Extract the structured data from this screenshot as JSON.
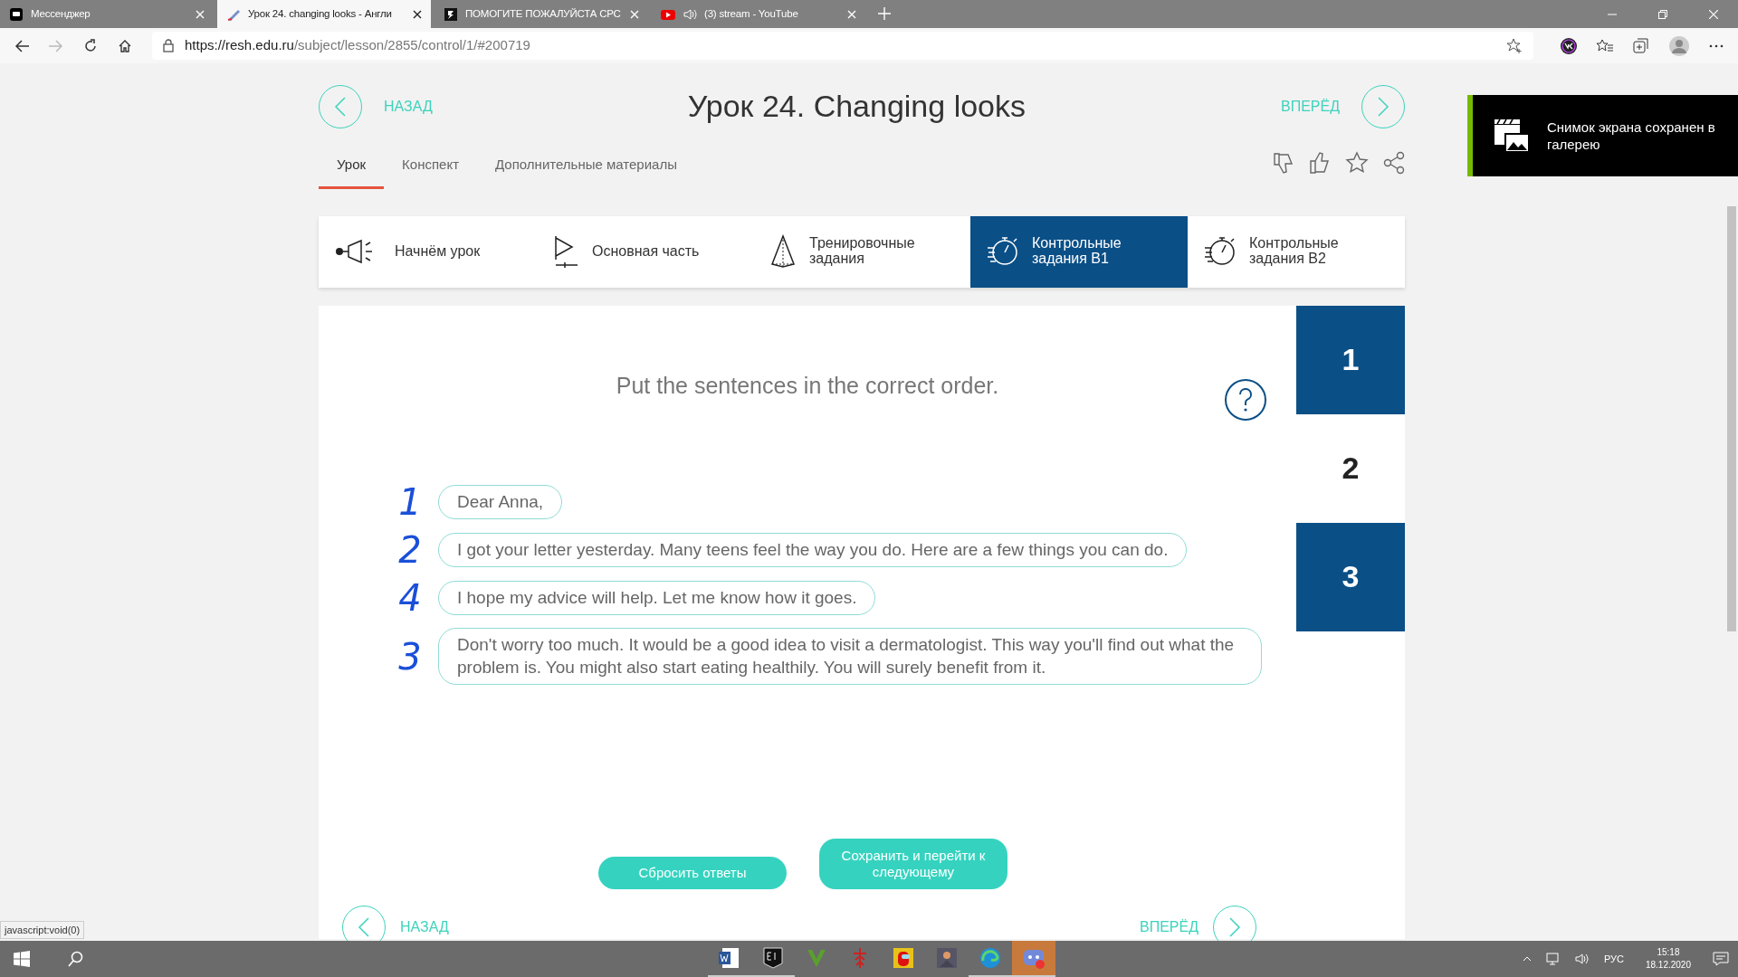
{
  "browser": {
    "tabs": [
      {
        "kind": "messenger",
        "title": "Мессенджер",
        "selected": false,
        "audio": false
      },
      {
        "kind": "lesson",
        "title": "Урок 24. changing looks - Англи",
        "selected": true,
        "audio": false
      },
      {
        "kind": "letter",
        "title": "ПОМОГИТЕ ПОЖАЛУЙСТА СРС",
        "selected": false,
        "audio": false
      },
      {
        "kind": "video",
        "title": "(3) stream - YouTube",
        "selected": false,
        "audio": true
      }
    ],
    "url": {
      "host": "https://resh.edu.ru",
      "path": "/subject/lesson/2855/control/1/#200719"
    },
    "status_text": "javascript:void(0)"
  },
  "page": {
    "prev_label": "НАЗАД",
    "next_label": "ВПЕРЁД",
    "title": "Урок 24. Changing looks",
    "lesson_tabs": [
      {
        "label": "Урок",
        "selected": true
      },
      {
        "label": "Конспект",
        "selected": false
      },
      {
        "label": "Дополнительные материалы",
        "selected": false
      }
    ],
    "sections": [
      {
        "kind": "megaphone",
        "label": "Начнём урок",
        "selected": false
      },
      {
        "kind": "play",
        "label": "Основная часть",
        "selected": false
      },
      {
        "kind": "pyramid",
        "label": "Тренировочные задания",
        "selected": false
      },
      {
        "kind": "timer",
        "label": "Контрольные задания В1",
        "selected": true
      },
      {
        "kind": "timer",
        "label": "Контрольные задания В2",
        "selected": false
      }
    ],
    "task": {
      "instruction": "Put the sentences in the correct order.",
      "numbers": [
        {
          "label": "1",
          "answered": true
        },
        {
          "label": "2",
          "answered": false
        },
        {
          "label": "3",
          "answered": true
        }
      ],
      "sentences": [
        {
          "annotation": "1",
          "text": "Dear Anna,"
        },
        {
          "annotation": "2",
          "text": "I got your letter yesterday. Many teens feel the way you do. Here are a few things you can do."
        },
        {
          "annotation": "4",
          "text": "I hope my advice will help. Let me know how it goes."
        },
        {
          "annotation": "3",
          "text": "Don't worry too much. It would be a good idea to visit a dermatologist. This way you'll find out what the problem is. You might also start eating healthily. You will surely benefit from it."
        }
      ]
    },
    "buttons": [
      "Сбросить ответы",
      "Сохранить и перейти к следующему"
    ],
    "bottom_prev": "НАЗАД",
    "bottom_next": "ВПЕРЁД"
  },
  "toast": {
    "text": "Снимок экрана сохранен в галерею"
  },
  "taskbar": {
    "apps": [
      {
        "kind": "word",
        "running": true,
        "active": false
      },
      {
        "kind": "epic",
        "running": true,
        "active": false
      },
      {
        "kind": "v",
        "running": false,
        "active": false
      },
      {
        "kind": "figure",
        "running": false,
        "active": false
      },
      {
        "kind": "crew",
        "running": false,
        "active": false
      },
      {
        "kind": "game",
        "running": false,
        "active": false
      },
      {
        "kind": "edge",
        "running": true,
        "active": false
      },
      {
        "kind": "chat",
        "running": true,
        "active": true
      }
    ],
    "lang": "РУС",
    "time": "15:18",
    "date": "18.12.2020"
  }
}
